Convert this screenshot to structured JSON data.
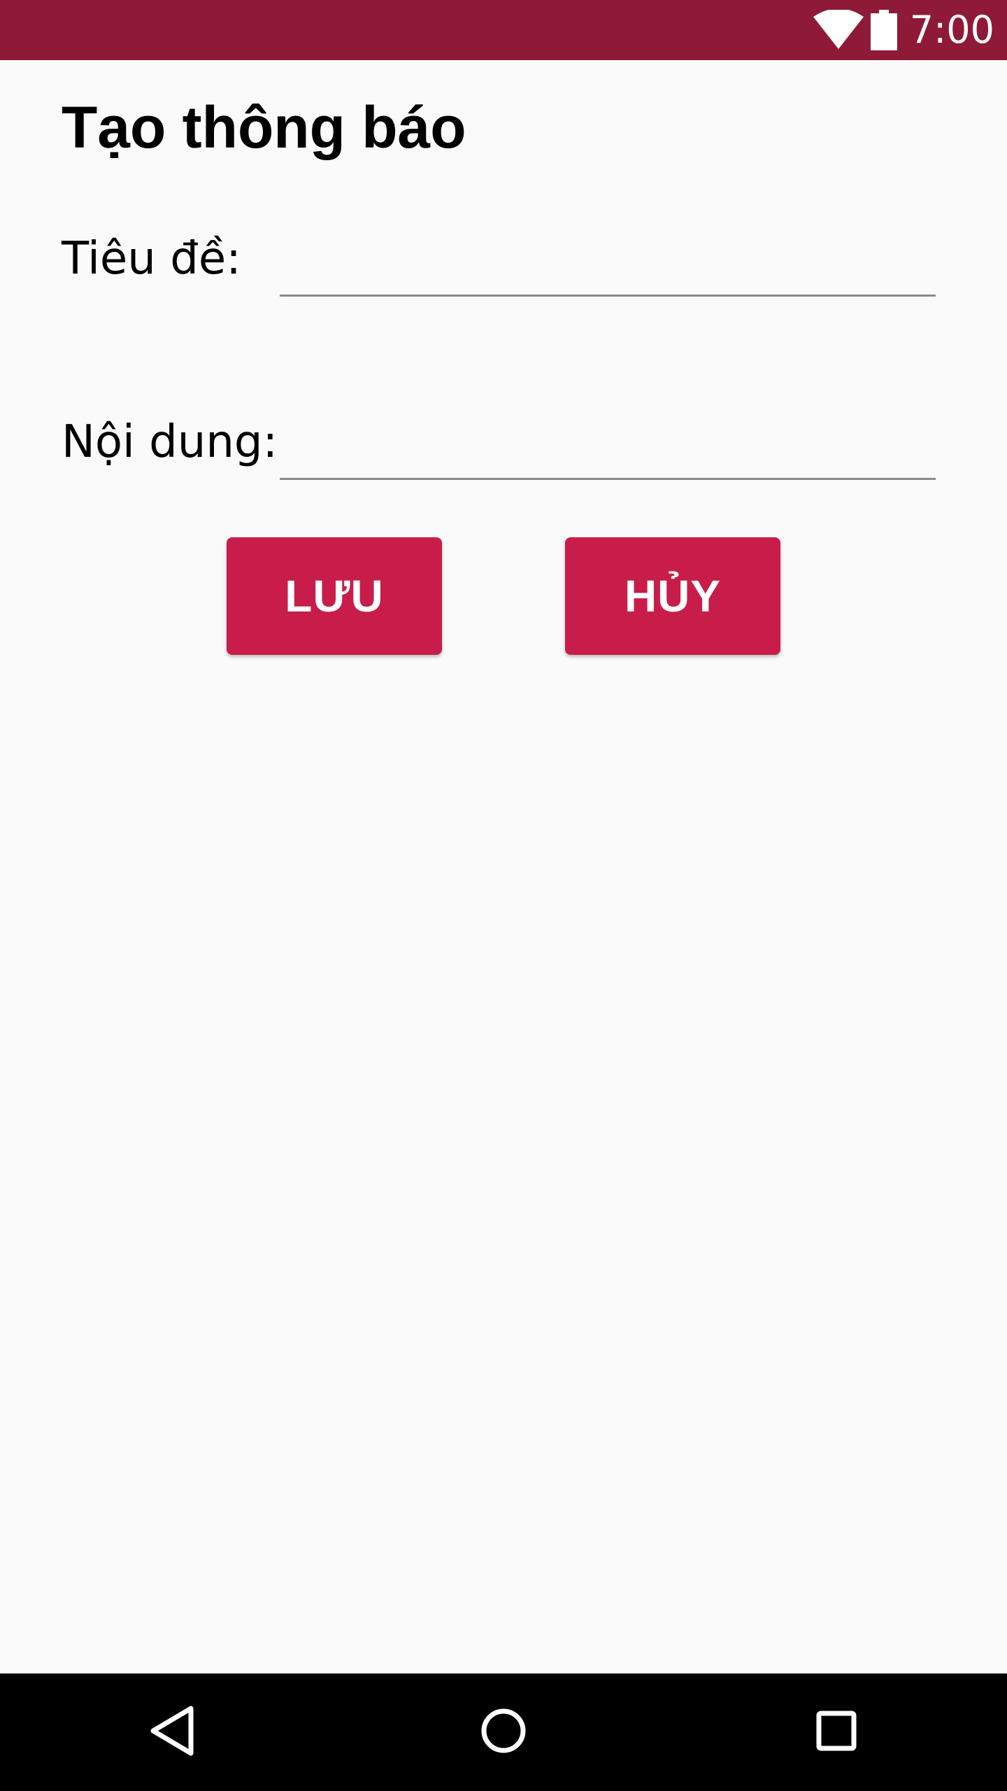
{
  "status_bar": {
    "time": "7:00",
    "icons": [
      "wifi-icon",
      "battery-icon"
    ],
    "background_color": "#8e1a38"
  },
  "page": {
    "title": "Tạo thông báo"
  },
  "form": {
    "title_label": "Tiêu đề:",
    "title_value": "",
    "content_label": "Nội dung:",
    "content_value": ""
  },
  "actions": {
    "save_label": "LƯU",
    "cancel_label": "HỦY",
    "button_color": "#c81d4a"
  },
  "nav_bar": {
    "icons": [
      "back-icon",
      "home-icon",
      "recents-icon"
    ]
  }
}
